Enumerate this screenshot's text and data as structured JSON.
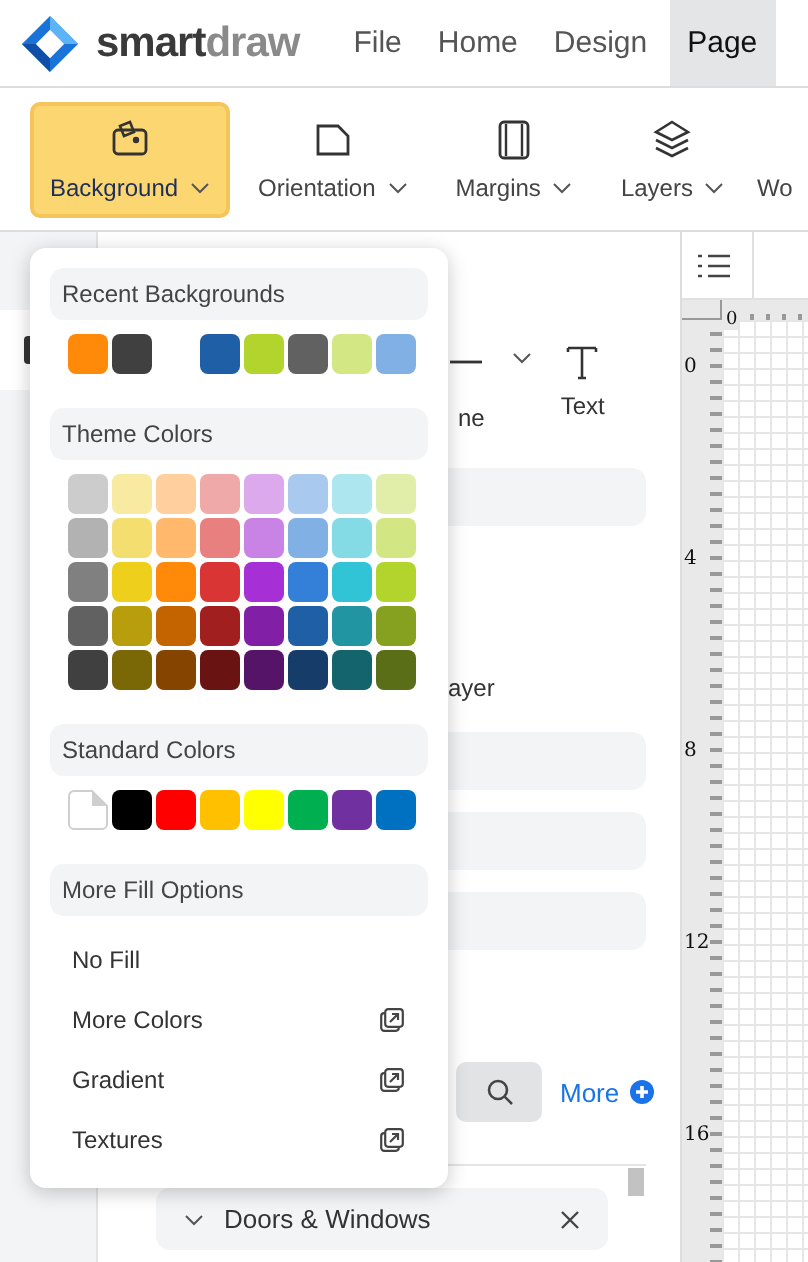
{
  "logo": {
    "wordmark_main": "smart",
    "wordmark_accent": "draw"
  },
  "menu": [
    {
      "label": "File",
      "selected": false
    },
    {
      "label": "Home",
      "selected": false
    },
    {
      "label": "Design",
      "selected": false
    },
    {
      "label": "Page",
      "selected": true
    }
  ],
  "ribbon": [
    {
      "label": "Background",
      "selected": true
    },
    {
      "label": "Orientation",
      "selected": false
    },
    {
      "label": "Margins",
      "selected": false
    },
    {
      "label": "Layers",
      "selected": false
    },
    {
      "label": "Wo",
      "selected": false
    }
  ],
  "panel": {
    "tools": [
      {
        "label": "ne"
      },
      {
        "label": "Text"
      }
    ],
    "layer_label": "ayer",
    "more_link": "More",
    "list_item": "Doors & Windows"
  },
  "canvas": {
    "top_ruler_labels": [
      "0"
    ],
    "left_ruler_labels": [
      "0",
      "4",
      "8",
      "12",
      "16"
    ]
  },
  "popup": {
    "sections": [
      {
        "title": "Recent Backgrounds",
        "swatches": [
          {
            "kind": "color",
            "color": "#ff8a0a"
          },
          {
            "kind": "color",
            "color": "#404040"
          },
          {
            "kind": "empty"
          },
          {
            "kind": "color",
            "color": "#1f5fa5"
          },
          {
            "kind": "color",
            "color": "#b2d42c"
          },
          {
            "kind": "color",
            "color": "#616161"
          },
          {
            "kind": "color",
            "color": "#d3e784"
          },
          {
            "kind": "color",
            "color": "#80b0e4"
          }
        ]
      },
      {
        "title": "Theme Colors",
        "swatches": [
          {
            "kind": "color",
            "color": "#cccccc"
          },
          {
            "kind": "color",
            "color": "#f8eaa0"
          },
          {
            "kind": "color",
            "color": "#ffcf9e"
          },
          {
            "kind": "color",
            "color": "#efa9a9"
          },
          {
            "kind": "color",
            "color": "#dcaaec"
          },
          {
            "kind": "color",
            "color": "#a9c9ee"
          },
          {
            "kind": "color",
            "color": "#ade6ee"
          },
          {
            "kind": "color",
            "color": "#e0eeaa"
          },
          {
            "kind": "color",
            "color": "#b2b2b2"
          },
          {
            "kind": "color",
            "color": "#f4de70"
          },
          {
            "kind": "color",
            "color": "#ffb86c"
          },
          {
            "kind": "color",
            "color": "#e88080"
          },
          {
            "kind": "color",
            "color": "#c983e4"
          },
          {
            "kind": "color",
            "color": "#80b0e4"
          },
          {
            "kind": "color",
            "color": "#84dbe6"
          },
          {
            "kind": "color",
            "color": "#d2e684"
          },
          {
            "kind": "color",
            "color": "#808080"
          },
          {
            "kind": "color",
            "color": "#eecf1c"
          },
          {
            "kind": "color",
            "color": "#ff8a0a"
          },
          {
            "kind": "color",
            "color": "#d93535"
          },
          {
            "kind": "color",
            "color": "#a630d6"
          },
          {
            "kind": "color",
            "color": "#3480d8"
          },
          {
            "kind": "color",
            "color": "#30c4d6"
          },
          {
            "kind": "color",
            "color": "#b2d42c"
          },
          {
            "kind": "color",
            "color": "#616161"
          },
          {
            "kind": "color",
            "color": "#b89d0c"
          },
          {
            "kind": "color",
            "color": "#c46400"
          },
          {
            "kind": "color",
            "color": "#a21f1f"
          },
          {
            "kind": "color",
            "color": "#811fa6"
          },
          {
            "kind": "color",
            "color": "#1f5fa5"
          },
          {
            "kind": "color",
            "color": "#2295a2"
          },
          {
            "kind": "color",
            "color": "#86a020"
          },
          {
            "kind": "color",
            "color": "#404040"
          },
          {
            "kind": "color",
            "color": "#7a6806"
          },
          {
            "kind": "color",
            "color": "#854400"
          },
          {
            "kind": "color",
            "color": "#6a1313"
          },
          {
            "kind": "color",
            "color": "#551468"
          },
          {
            "kind": "color",
            "color": "#163d6a"
          },
          {
            "kind": "color",
            "color": "#14646e"
          },
          {
            "kind": "color",
            "color": "#5a6d17"
          }
        ]
      },
      {
        "title": "Standard Colors",
        "swatches": [
          {
            "kind": "none"
          },
          {
            "kind": "color",
            "color": "#000000"
          },
          {
            "kind": "color",
            "color": "#ff0000"
          },
          {
            "kind": "color",
            "color": "#ffc000"
          },
          {
            "kind": "color",
            "color": "#ffff00"
          },
          {
            "kind": "color",
            "color": "#00b050"
          },
          {
            "kind": "color",
            "color": "#7030a0"
          },
          {
            "kind": "color",
            "color": "#0070c0"
          }
        ]
      },
      {
        "title": "More Fill Options",
        "options": [
          {
            "label": "No Fill",
            "external": false
          },
          {
            "label": "More Colors",
            "external": true
          },
          {
            "label": "Gradient",
            "external": true
          },
          {
            "label": "Textures",
            "external": true
          }
        ]
      }
    ]
  }
}
